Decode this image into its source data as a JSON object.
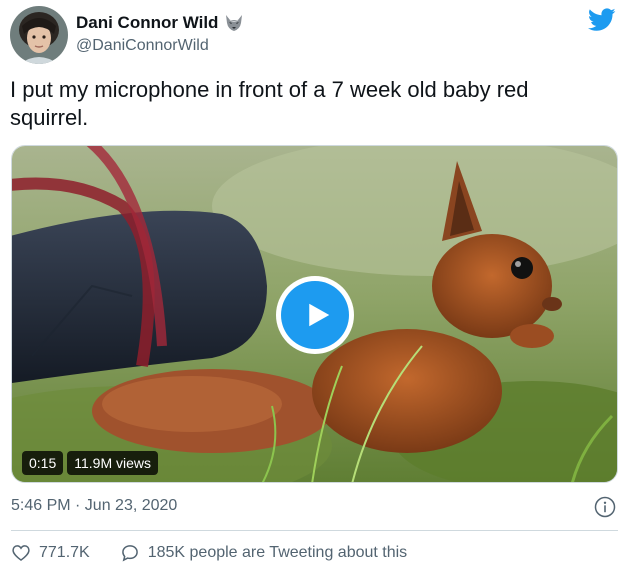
{
  "author": {
    "display_name": "Dani Connor Wild",
    "handle": "@DaniConnorWild",
    "badge_icon": "wolf-icon"
  },
  "brand": {
    "logo_icon": "twitter-bird-icon",
    "color": "#1d9bf0"
  },
  "tweet": {
    "text": "I put my microphone in front of a 7 week old baby red squirrel."
  },
  "video": {
    "duration": "0:15",
    "views": "11.9M views",
    "play_icon": "play-icon"
  },
  "meta": {
    "timestamp": "5:46 PM · Jun 23, 2020",
    "info_icon": "info-icon"
  },
  "actions": {
    "like_count": "771.7K",
    "tweeting_text": "185K people are Tweeting about this"
  }
}
